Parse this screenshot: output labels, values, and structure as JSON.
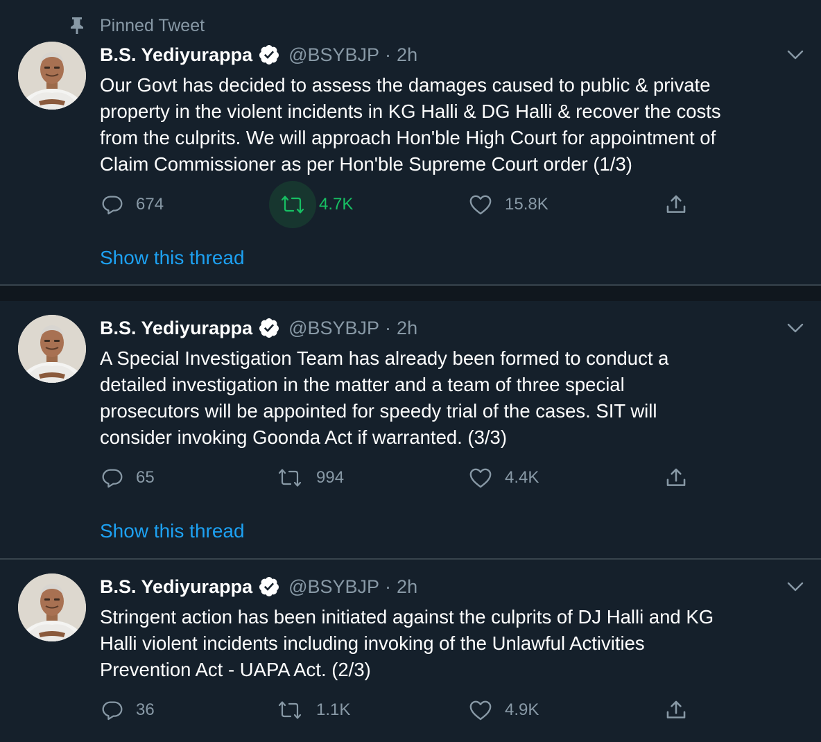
{
  "pinned_label": "Pinned Tweet",
  "account": {
    "name": "B.S. Yediyurappa",
    "handle": "@BSYBJP",
    "separator": "·"
  },
  "show_thread_label": "Show this thread",
  "colors": {
    "background": "#15202b",
    "separator_band": "#10171e",
    "secondary_text": "#8899a6",
    "link": "#1da1f2",
    "retweet_active": "#17bf63",
    "verified_badge": "#ffffff"
  },
  "icons": [
    "pin-icon",
    "verified-icon",
    "chevron-down-icon",
    "reply-icon",
    "retweet-icon",
    "like-icon",
    "share-icon"
  ],
  "tweets": [
    {
      "time": "2h",
      "text": "Our Govt has decided to assess the damages caused to public & private\nproperty in the violent incidents in KG Halli & DG Halli & recover the costs\nfrom the culprits. We will approach Hon'ble High Court for appointment of\nClaim Commissioner as per Hon'ble Supreme Court order (1/3)",
      "replies": "674",
      "retweets": "4.7K",
      "likes": "15.8K",
      "retweet_active": true
    },
    {
      "time": "2h",
      "text": "A Special Investigation Team has already been formed to conduct a\ndetailed investigation in the matter and a team of three special\nprosecutors will be appointed for speedy trial of the cases. SIT will\nconsider invoking Goonda Act if warranted.  (3/3)",
      "replies": "65",
      "retweets": "994",
      "likes": "4.4K",
      "retweet_active": false
    },
    {
      "time": "2h",
      "text": "Stringent action has been initiated against the culprits of DJ Halli and KG\nHalli violent incidents including invoking of the Unlawful Activities\nPrevention Act - UAPA Act. (2/3)",
      "replies": "36",
      "retweets": "1.1K",
      "likes": "4.9K",
      "retweet_active": false
    }
  ]
}
